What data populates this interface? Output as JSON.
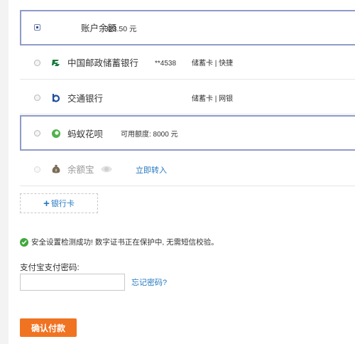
{
  "payment_methods": [
    {
      "name": "账户余额",
      "detail": "323.50 元"
    },
    {
      "name": "中国邮政储蓄银行",
      "card_no": "**4538",
      "card_type": "储蓄卡 | 快捷"
    },
    {
      "name": "交通银行",
      "card_type": "储蓄卡 | 网银"
    },
    {
      "name": "蚂蚁花呗",
      "detail": "可用额度: 8000 元"
    },
    {
      "name": "余额宝",
      "action": "立即转入"
    }
  ],
  "add_card_label": "银行卡",
  "security_notice": "安全设置检测成功! 数字证书正在保护中, 无需短信校验。",
  "password": {
    "label": "支付宝支付密码:",
    "value": "",
    "forgot_link": "忘记密码?"
  },
  "confirm_button": "确认付款",
  "colors": {
    "accent": "#f07322",
    "link": "#2478c0",
    "selected_border": "#8e9bc9",
    "success": "#3fa83a"
  }
}
